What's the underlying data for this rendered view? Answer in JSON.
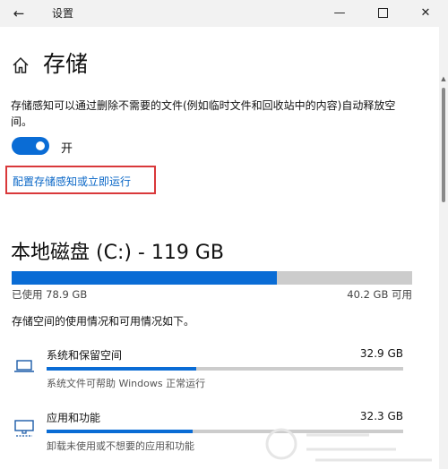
{
  "window": {
    "title": "设置",
    "back_icon": "arrow-left-icon",
    "minimize_icon": "minimize-icon",
    "maximize_icon": "maximize-icon",
    "close_icon": "close-icon"
  },
  "header": {
    "icon": "home-icon",
    "title": "存储"
  },
  "storage_sense": {
    "description": "存储感知可以通过删除不需要的文件(例如临时文件和回收站中的内容)自动释放空间。",
    "toggle_state": "开",
    "toggle_on": true,
    "config_link": "配置存储感知或立即运行"
  },
  "drive": {
    "title": "本地磁盘 (C:) - 119 GB",
    "used_fraction": 0.662,
    "used_label": "已使用 78.9 GB",
    "available_label": "40.2 GB 可用",
    "usage_note": "存储空间的使用情况和可用情况如下。"
  },
  "categories": [
    {
      "icon": "laptop-icon",
      "name": "系统和保留空间",
      "size": "32.9 GB",
      "fraction": 0.42,
      "subtitle": "系统文件可帮助 Windows 正常运行"
    },
    {
      "icon": "monitor-keyboard-icon",
      "name": "应用和功能",
      "size": "32.3 GB",
      "fraction": 0.41,
      "subtitle": "卸载未使用或不想要的应用和功能"
    }
  ],
  "colors": {
    "accent": "#0a6cd5",
    "highlight_box": "#d9383a",
    "link": "#0a67c7",
    "bar_track": "#cccccc"
  }
}
